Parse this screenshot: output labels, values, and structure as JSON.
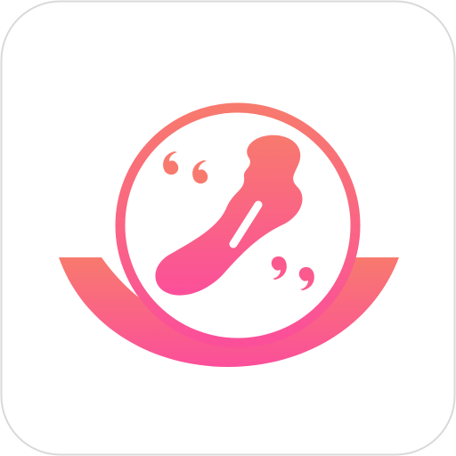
{
  "icon": {
    "kind": "app-launcher-icon",
    "shape": "rounded-square",
    "background_color": "#ffffff",
    "border_color": "#d9d9d9",
    "emblem": "speech-bubble-with-sanitary-pad",
    "gradient_top": "#f87a6e",
    "gradient_bottom": "#fb4f9a"
  }
}
